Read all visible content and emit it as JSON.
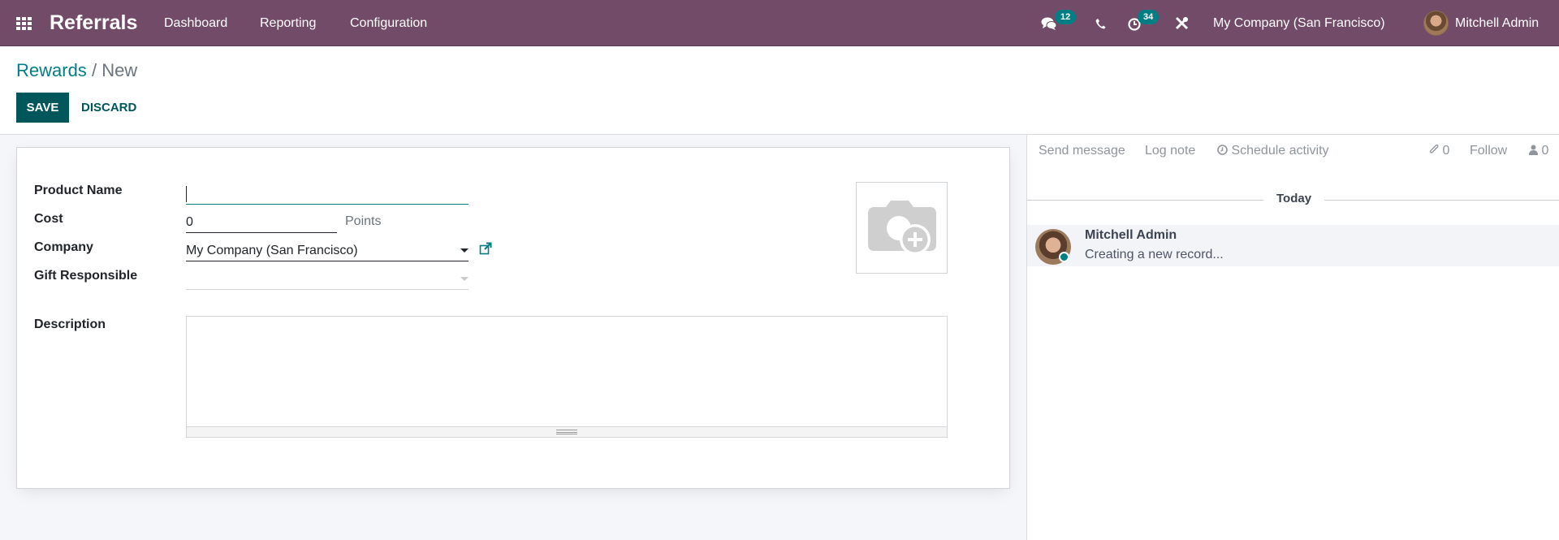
{
  "navbar": {
    "app_name": "Referrals",
    "menu": [
      "Dashboard",
      "Reporting",
      "Configuration"
    ],
    "messages_badge": "12",
    "activities_badge": "34",
    "company": "My Company (San Francisco)",
    "user": "Mitchell Admin",
    "icons": [
      "apps-grid-icon",
      "chat-icon",
      "phone-icon",
      "clock-icon",
      "tools-icon",
      "user-avatar"
    ]
  },
  "breadcrumb": {
    "parent": "Rewards",
    "separator": "/",
    "current": "New"
  },
  "actions": {
    "save": "SAVE",
    "discard": "DISCARD"
  },
  "form": {
    "product_name": {
      "label": "Product Name",
      "value": ""
    },
    "cost": {
      "label": "Cost",
      "value": "0",
      "unit": "Points"
    },
    "company": {
      "label": "Company",
      "value": "My Company (San Francisco)"
    },
    "gift_responsible": {
      "label": "Gift Responsible",
      "value": ""
    },
    "description": {
      "label": "Description",
      "value": ""
    },
    "image_placeholder_icon": "camera-add-icon"
  },
  "chatter": {
    "send_message": "Send message",
    "log_note": "Log note",
    "schedule_activity": "Schedule activity",
    "attachments_count": "0",
    "follow": "Follow",
    "followers_count": "0",
    "date_separator": "Today",
    "messages": [
      {
        "author": "Mitchell Admin",
        "body": "Creating a new record..."
      }
    ]
  },
  "colors": {
    "navbar": "#714b67",
    "primary": "#00575b",
    "accent": "#017e84"
  }
}
